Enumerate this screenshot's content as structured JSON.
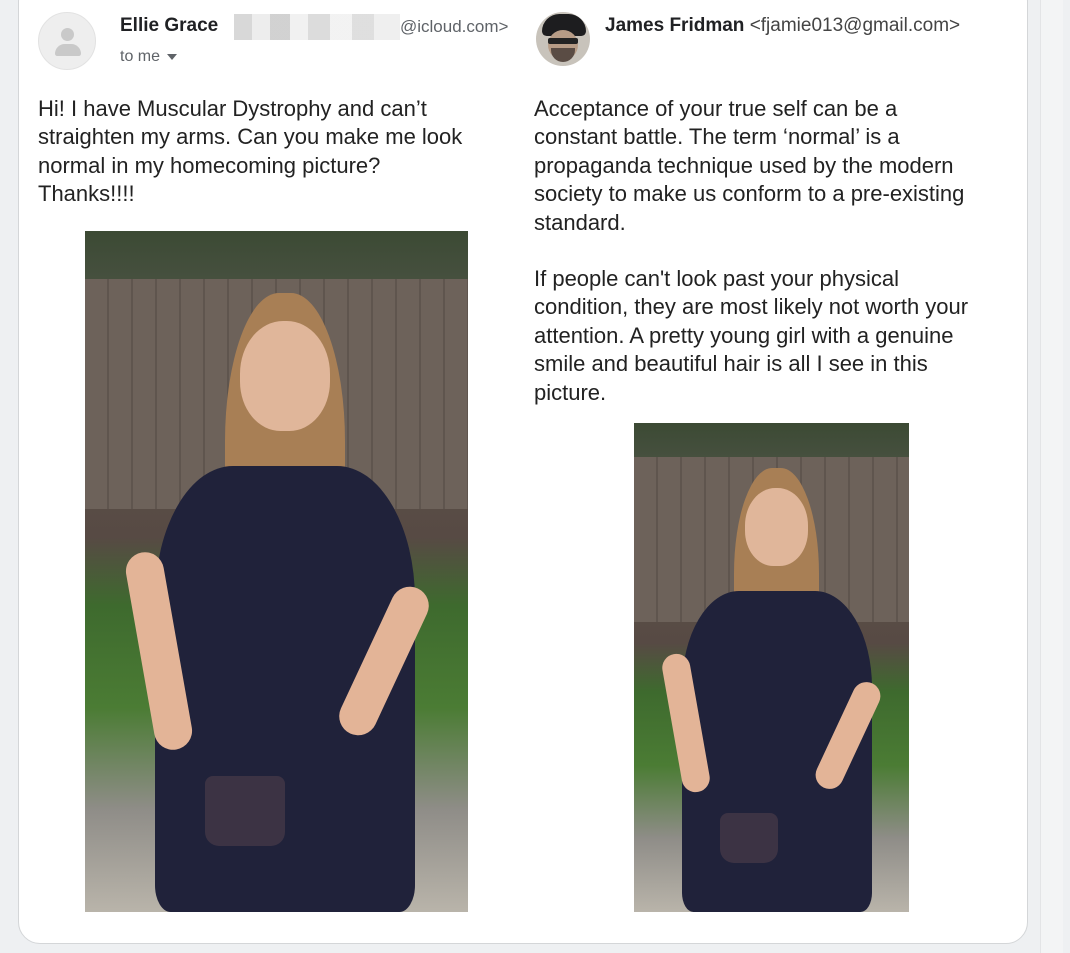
{
  "left_message": {
    "sender_name": "Ellie Grace",
    "sender_email_domain": "@icloud.com>",
    "recipient_label": "to me",
    "body": "Hi! I have Muscular Dystrophy and can’t\nstraighten my arms. Can you make me look\nnormal in my homecoming picture?\nThanks!!!!"
  },
  "right_message": {
    "sender_name": "James Fridman",
    "sender_email": "<fjamie013@gmail.com>",
    "body_paragraph_1": "Acceptance of your true self can be a\nconstant battle. The term ‘normal’ is a\npropaganda technique used by the modern\nsociety to make us conform to a pre-existing\nstandard.",
    "body_paragraph_2": "If people can't look past your physical\ncondition, they are most likely not worth your\nattention. A pretty young girl with a genuine\nsmile and beautiful hair is all I see in this\npicture."
  },
  "icons": {
    "left_avatar": "default-user-icon",
    "right_avatar": "profile-photo",
    "recipient_dropdown": "caret-down-icon"
  },
  "colors": {
    "card_background": "#ffffff",
    "page_background": "#eef0f2",
    "text": "#222222",
    "secondary_text": "#5f6368"
  }
}
